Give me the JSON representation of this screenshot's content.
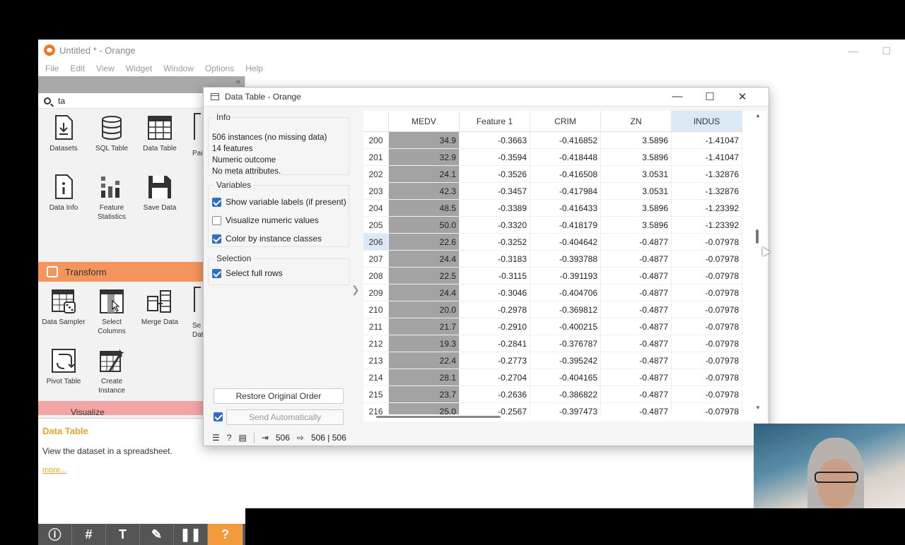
{
  "main_window": {
    "title": "Untitled * - Orange",
    "menu": [
      "File",
      "Edit",
      "View",
      "Widget",
      "Window",
      "Options",
      "Help"
    ]
  },
  "left_panel": {
    "collapse_glyph": "«",
    "search_value": "ta",
    "widgets_data": [
      {
        "label": "Datasets",
        "icon": "datasets-icon"
      },
      {
        "label": "SQL Table",
        "icon": "sql-table-icon"
      },
      {
        "label": "Data Table",
        "icon": "data-table-icon"
      },
      {
        "label": "Data Info",
        "icon": "data-info-icon"
      },
      {
        "label": "Feature Statistics",
        "icon": "feature-statistics-icon"
      },
      {
        "label": "Save Data",
        "icon": "save-data-icon"
      }
    ],
    "partial_labels": {
      "data_top": "Pai",
      "transform_top": "Se",
      "transform_top2": "Dat"
    },
    "transform_section": "Transform",
    "widgets_transform": [
      {
        "label": "Data Sampler",
        "icon": "data-sampler-icon"
      },
      {
        "label": "Select Columns",
        "icon": "select-columns-icon"
      },
      {
        "label": "Merge Data",
        "icon": "merge-data-icon"
      },
      {
        "label": "Pivot Table",
        "icon": "pivot-table-icon"
      },
      {
        "label": "Create Instance",
        "icon": "create-instance-icon"
      }
    ],
    "visualize_section": "Visualize",
    "help": {
      "title": "Data Table",
      "description": "View the dataset in a spreadsheet.",
      "more": "more..."
    },
    "toolbar": [
      "info-icon",
      "grid-icon",
      "text-icon",
      "pen-icon",
      "pause-icon",
      "help-icon"
    ]
  },
  "data_table": {
    "title": "Data Table - Orange",
    "info": {
      "title": "Info",
      "lines": [
        "506 instances (no missing data)",
        "14 features",
        "Numeric outcome",
        "No meta attributes."
      ]
    },
    "variables": {
      "title": "Variables",
      "show_labels": "Show variable labels (if present)",
      "visualize": "Visualize numeric values",
      "color_by": "Color by instance classes"
    },
    "selection": {
      "title": "Selection",
      "select_full_rows": "Select full rows"
    },
    "restore_button": "Restore Original Order",
    "send_button": "Send Automatically",
    "status": {
      "input": "506",
      "output": "506 | 506"
    },
    "columns": [
      "MEDV",
      "Feature 1",
      "CRIM",
      "ZN",
      "INDUS"
    ],
    "rows": [
      [
        "200",
        "34.9",
        "-0.3663",
        "-0.416852",
        "3.5896",
        "-1.41047"
      ],
      [
        "201",
        "32.9",
        "-0.3594",
        "-0.418448",
        "3.5896",
        "-1.41047"
      ],
      [
        "202",
        "24.1",
        "-0.3526",
        "-0.416508",
        "3.0531",
        "-1.32876"
      ],
      [
        "203",
        "42.3",
        "-0.3457",
        "-0.417984",
        "3.0531",
        "-1.32876"
      ],
      [
        "204",
        "48.5",
        "-0.3389",
        "-0.416433",
        "3.5896",
        "-1.23392"
      ],
      [
        "205",
        "50.0",
        "-0.3320",
        "-0.418179",
        "3.5896",
        "-1.23392"
      ],
      [
        "206",
        "22.6",
        "-0.3252",
        "-0.404642",
        "-0.4877",
        "-0.07978"
      ],
      [
        "207",
        "24.4",
        "-0.3183",
        "-0.393788",
        "-0.4877",
        "-0.07978"
      ],
      [
        "208",
        "22.5",
        "-0.3115",
        "-0.391193",
        "-0.4877",
        "-0.07978"
      ],
      [
        "209",
        "24.4",
        "-0.3046",
        "-0.404706",
        "-0.4877",
        "-0.07978"
      ],
      [
        "210",
        "20.0",
        "-0.2978",
        "-0.369812",
        "-0.4877",
        "-0.07978"
      ],
      [
        "211",
        "21.7",
        "-0.2910",
        "-0.400215",
        "-0.4877",
        "-0.07978"
      ],
      [
        "212",
        "19.3",
        "-0.2841",
        "-0.376787",
        "-0.4877",
        "-0.07978"
      ],
      [
        "213",
        "22.4",
        "-0.2773",
        "-0.395242",
        "-0.4877",
        "-0.07978"
      ],
      [
        "214",
        "28.1",
        "-0.2704",
        "-0.404165",
        "-0.4877",
        "-0.07978"
      ],
      [
        "215",
        "23.7",
        "-0.2636",
        "-0.386822",
        "-0.4877",
        "-0.07978"
      ],
      [
        "216",
        "25.0",
        "-0.2567",
        "-0.397473",
        "-0.4877",
        "-0.07978"
      ]
    ],
    "highlighted_row": "206"
  },
  "colors": {
    "accent": "#f29b3c",
    "transform": "#f4955d",
    "visualize": "#f3a5a5",
    "bar": "#a3a3a3",
    "selected": "#dbe9f7"
  }
}
